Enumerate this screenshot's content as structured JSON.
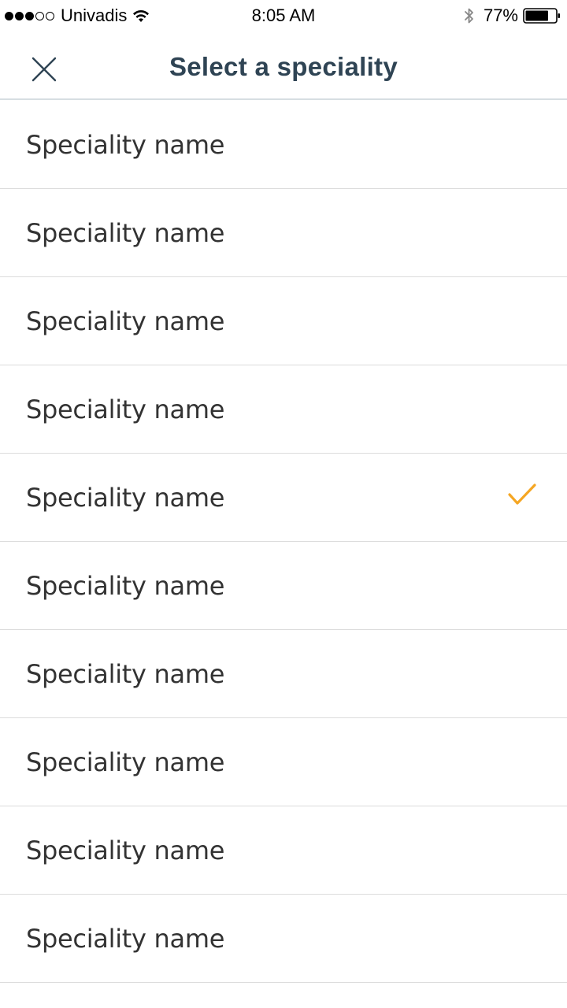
{
  "status_bar": {
    "carrier": "Univadis",
    "time": "8:05 AM",
    "battery_percent": "77%",
    "signal_bars_full": 3,
    "signal_bars_total": 5,
    "battery_level": 0.77
  },
  "nav": {
    "title": "Select a speciality",
    "close_icon": "close-icon"
  },
  "list": {
    "items": [
      {
        "label": "Speciality name",
        "selected": false
      },
      {
        "label": "Speciality name",
        "selected": false
      },
      {
        "label": "Speciality name",
        "selected": false
      },
      {
        "label": "Speciality name",
        "selected": false
      },
      {
        "label": "Speciality name",
        "selected": true
      },
      {
        "label": "Speciality name",
        "selected": false
      },
      {
        "label": "Speciality name",
        "selected": false
      },
      {
        "label": "Speciality name",
        "selected": false
      },
      {
        "label": "Speciality name",
        "selected": false
      },
      {
        "label": "Speciality name",
        "selected": false
      }
    ]
  },
  "colors": {
    "title": "#2f4454",
    "check": "#f5a623",
    "divider": "#dcdcdc",
    "text": "#333333"
  }
}
